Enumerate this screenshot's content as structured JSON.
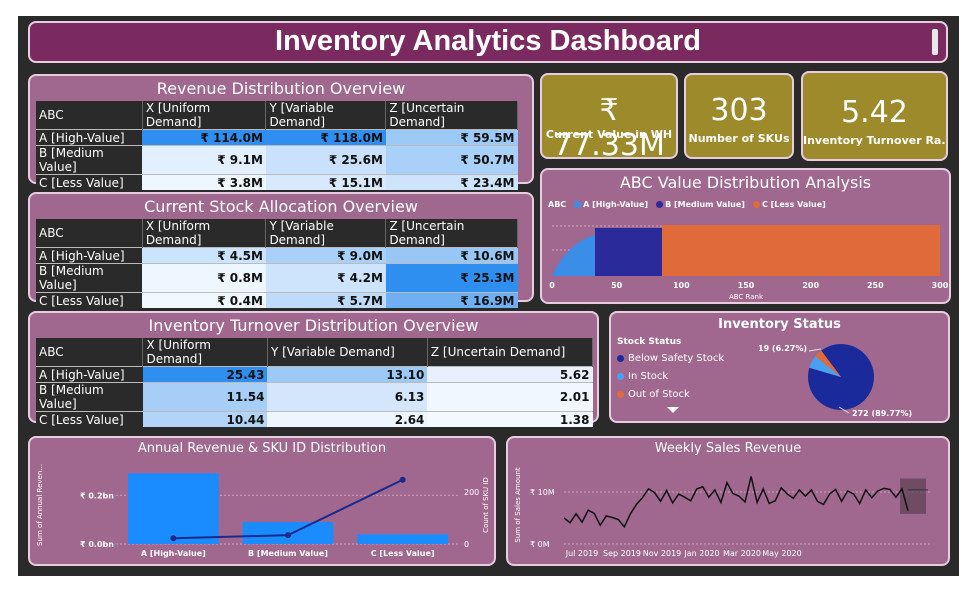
{
  "header": {
    "title": "Inventory Analytics Dashboard"
  },
  "revenue_matrix": {
    "title": "Revenue Distribution Overview",
    "columns": [
      "ABC",
      "X [Uniform Demand]",
      "Y [Variable Demand]",
      "Z [Uncertain Demand]"
    ],
    "rows": [
      {
        "label": "A [High-Value]",
        "cells": [
          "₹ 114.0M",
          "₹ 118.0M",
          "₹ 59.5M"
        ],
        "colors": [
          "#2f8ff0",
          "#2f8ff0",
          "#9cc9f6"
        ]
      },
      {
        "label": "B [Medium Value]",
        "cells": [
          "₹ 9.1M",
          "₹ 25.6M",
          "₹ 50.7M"
        ],
        "colors": [
          "#e2efff",
          "#c9e1fc",
          "#a9d0f8"
        ]
      },
      {
        "label": "C [Less Value]",
        "cells": [
          "₹ 3.8M",
          "₹ 15.1M",
          "₹ 23.4M"
        ],
        "colors": [
          "#eef6ff",
          "#d8e9fd",
          "#cde4fc"
        ]
      }
    ]
  },
  "stock_matrix": {
    "title": "Current Stock Allocation Overview",
    "columns": [
      "ABC",
      "X [Uniform Demand]",
      "Y [Variable Demand]",
      "Z [Uncertain Demand]"
    ],
    "rows": [
      {
        "label": "A [High-Value]",
        "cells": [
          "₹ 4.5M",
          "₹ 9.0M",
          "₹ 10.6M"
        ],
        "colors": [
          "#cbe3fc",
          "#a9d0f8",
          "#98c7f6"
        ]
      },
      {
        "label": "B [Medium Value]",
        "cells": [
          "₹ 0.8M",
          "₹ 4.2M",
          "₹ 25.3M"
        ],
        "colors": [
          "#eef6ff",
          "#cde4fc",
          "#2f8ff0"
        ]
      },
      {
        "label": "C [Less Value]",
        "cells": [
          "₹ 0.4M",
          "₹ 5.7M",
          "₹ 16.9M"
        ],
        "colors": [
          "#f2f8ff",
          "#bedcfa",
          "#6fb0f3"
        ]
      }
    ]
  },
  "turnover_matrix": {
    "title": "Inventory Turnover Distribution Overview",
    "columns": [
      "ABC",
      "X [Uniform Demand]",
      "Y [Variable Demand]",
      "Z [Uncertain Demand]"
    ],
    "rows": [
      {
        "label": "A [High-Value]",
        "cells": [
          "25.43",
          "13.10",
          "5.62"
        ],
        "colors": [
          "#2f8ff0",
          "#9cc9f6",
          "#e7f1fe"
        ]
      },
      {
        "label": "B [Medium Value]",
        "cells": [
          "11.54",
          "6.13",
          "2.01"
        ],
        "colors": [
          "#a6cef7",
          "#d3e6fc",
          "#f1f7ff"
        ]
      },
      {
        "label": "C [Less Value]",
        "cells": [
          "10.44",
          "2.64",
          "1.38"
        ],
        "colors": [
          "#b1d4f8",
          "#edf5ff",
          "#f4f9ff"
        ]
      }
    ]
  },
  "kpis": [
    {
      "value": "₹ 77.33M",
      "label": "Current Value in WH"
    },
    {
      "value": "303",
      "label": "Number of SKUs"
    },
    {
      "value": "5.42",
      "label": "Inventory Turnover Ra..."
    }
  ],
  "abc_chart": {
    "title": "ABC Value Distribution Analysis",
    "legend_title": "ABC",
    "legend": [
      {
        "name": "A [High-Value]",
        "color": "#3a8ee8"
      },
      {
        "name": "B [Medium Value]",
        "color": "#2a2a9a"
      },
      {
        "name": "C [Less Value]",
        "color": "#e06a3a"
      }
    ],
    "xlabel": "ABC Rank",
    "xticks": [
      "0",
      "50",
      "100",
      "150",
      "200",
      "250",
      "300"
    ]
  },
  "inventory_status": {
    "title": "Inventory Status",
    "legend_title": "Stock Status",
    "legend": [
      {
        "name": "Below Safety Stock",
        "color": "#1a2a9a"
      },
      {
        "name": "In Stock",
        "color": "#4aa0f0"
      },
      {
        "name": "Out of Stock",
        "color": "#e06a3a"
      }
    ],
    "label_small": "19 (6.27%)",
    "label_big": "272 (89.77%)",
    "slices": [
      {
        "name": "Below Safety Stock",
        "value": 272,
        "color": "#1a2a9a"
      },
      {
        "name": "In Stock",
        "value": 19,
        "color": "#4aa0f0"
      },
      {
        "name": "Out of Stock",
        "value": 12,
        "color": "#e06a3a"
      }
    ]
  },
  "chart_data": [
    {
      "type": "bar",
      "title": "Annual Revenue & SKU ID Distribution",
      "categories": [
        "A [High-Value]",
        "B [Medium Value]",
        "C [Less Value]"
      ],
      "series": [
        {
          "name": "Sum of Annual Revenue",
          "values": [
            0.29,
            0.09,
            0.04
          ],
          "color": "#1a8cff"
        },
        {
          "name": "Count of SKU ID",
          "values": [
            22,
            34,
            247
          ],
          "color": "#1a2a8a"
        }
      ],
      "ylabel": "Sum of Annual Reven...",
      "y2label": "Count of SKU ID",
      "yticks": [
        "₹ 0.0bn",
        "₹ 0.2bn"
      ],
      "y2ticks": [
        "0",
        "200"
      ],
      "ylim": [
        0,
        0.32
      ],
      "y2lim": [
        0,
        300
      ]
    },
    {
      "type": "line",
      "title": "Weekly Sales Revenue",
      "ylabel": "Sum of Sales Amount",
      "yticks": [
        "₹ 0M",
        "₹ 10M"
      ],
      "ylim": [
        0,
        15
      ],
      "xticks": [
        "Jul 2019",
        "Sep 2019",
        "Nov 2019",
        "Jan 2020",
        "Mar 2020",
        "May 2020"
      ],
      "values": [
        5.0,
        4.1,
        5.8,
        4.2,
        6.5,
        5.9,
        3.6,
        5.4,
        5.1,
        4.7,
        3.3,
        5.8,
        7.6,
        8.9,
        10.6,
        9.9,
        8.2,
        10.3,
        7.9,
        9.6,
        9.0,
        8.3,
        10.6,
        11.0,
        9.0,
        10.4,
        8.0,
        11.8,
        9.7,
        9.2,
        8.1,
        13.0,
        8.0,
        10.6,
        7.8,
        8.3,
        10.8,
        9.6,
        8.8,
        10.4,
        9.2,
        10.4,
        8.2,
        7.6,
        9.6,
        10.5,
        8.2,
        10.2,
        9.6,
        7.8,
        10.4,
        8.9,
        10.2,
        10.7,
        10.5,
        9.0,
        10.6,
        6.4
      ],
      "color": "#111111"
    }
  ]
}
